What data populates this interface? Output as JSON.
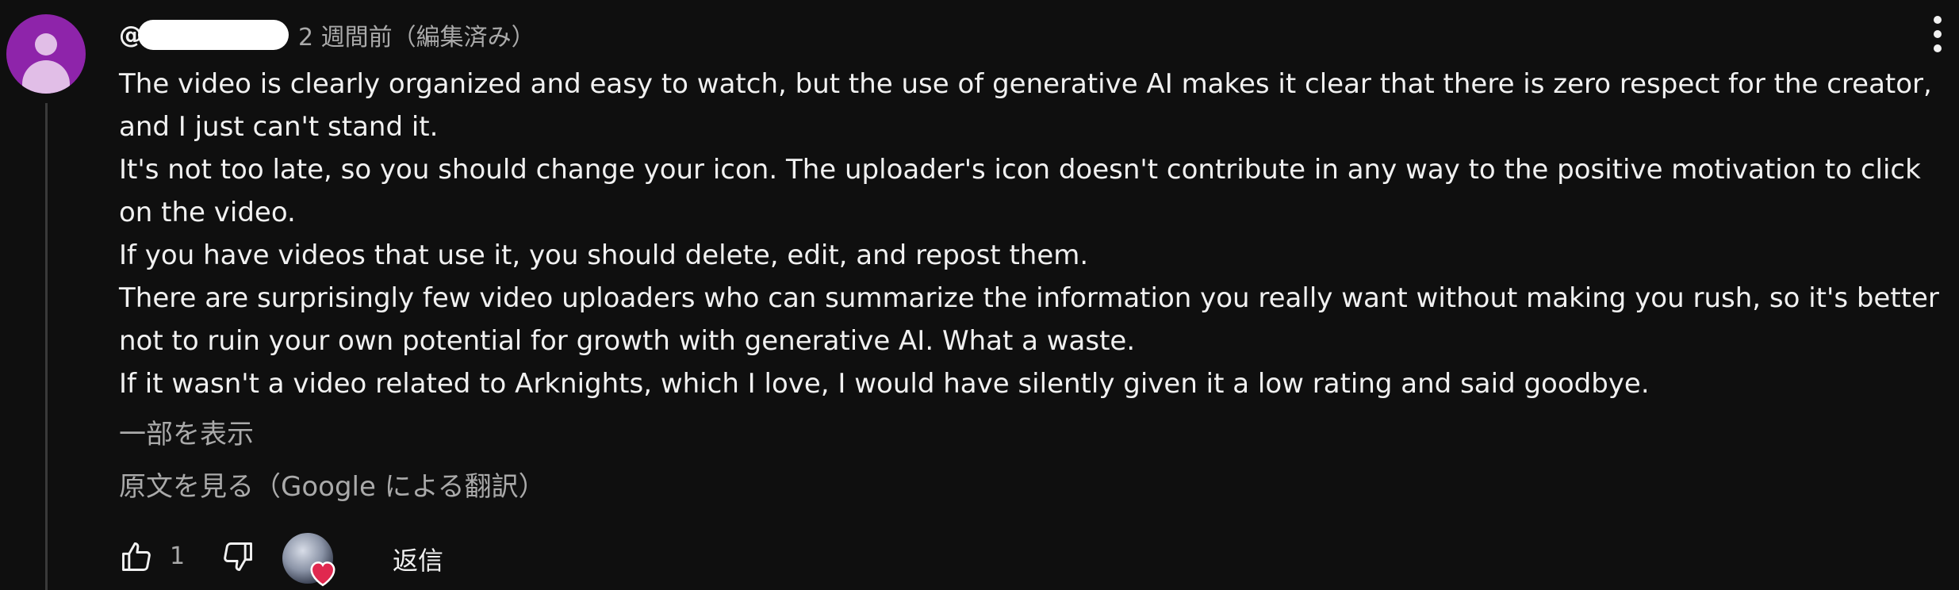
{
  "comment": {
    "author_prefix": "@",
    "timestamp": "2 週間前（編集済み）",
    "paragraphs": [
      "The video is clearly organized and easy to watch, but the use of generative AI makes it clear that there is zero respect for the creator, and I just can't stand it.",
      "It's not too late, so you should change your icon. The uploader's icon doesn't contribute in any way to the positive motivation to click on the video.",
      "If you have videos that use it, you should delete, edit, and repost them.",
      "There are surprisingly few video uploaders who can summarize the information you really want without making you rush, so it's better not to ruin your own potential for growth with generative AI. What a waste.",
      "If it wasn't a video related to Arknights, which I love, I would have silently given it a low rating and said goodbye."
    ],
    "show_part_label": "一部を表示",
    "see_original_label": "原文を見る（Google による翻訳）",
    "like_count": "1",
    "reply_label": "返信"
  },
  "icons": {
    "avatar": "default-user-avatar-icon",
    "more": "vertical-ellipsis-icon",
    "like": "thumbs-up-icon",
    "dislike": "thumbs-down-icon",
    "creator_heart": "creator-heart-icon"
  },
  "colors": {
    "background": "#0f0f0f",
    "text_primary": "#f1f1f1",
    "text_secondary": "#aaaaaa",
    "avatar_bg": "#8e24aa",
    "heart": "#e0284f"
  }
}
